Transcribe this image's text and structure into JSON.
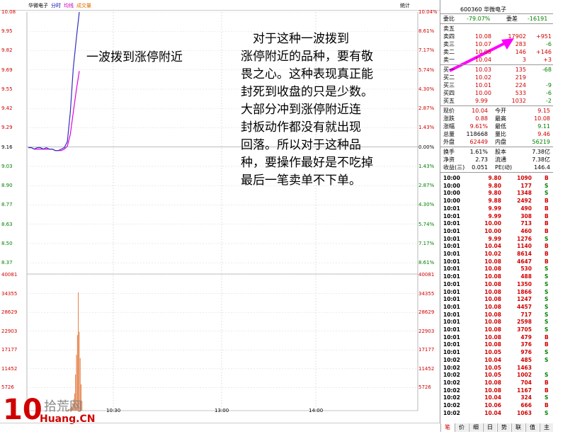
{
  "header": {
    "stock_name": "华微电子",
    "tab_fenshi": "分时",
    "tab_junxian": "均线",
    "tab_chengjiaoliang": "成交量",
    "tongji": "统计",
    "code_and_name": "600360 华微电子"
  },
  "left_axis_price": [
    "10.08",
    "9.95",
    "9.82",
    "9.69",
    "9.55",
    "9.42",
    "9.29",
    "9.16",
    "9.03",
    "8.90",
    "8.77",
    "8.63",
    "8.50",
    "8.37"
  ],
  "right_axis_pct": [
    "10.04%",
    "8.61%",
    "7.17%",
    "5.74%",
    "4.30%",
    "2.87%",
    "1.43%",
    "0.00%",
    "1.43%",
    "2.87%",
    "4.30%",
    "5.74%",
    "7.17%",
    "8.61%"
  ],
  "volume_axis": [
    "40081",
    "34355",
    "28629",
    "22903",
    "17177",
    "11452",
    "5726"
  ],
  "time_axis": [
    "10:30",
    "13:00",
    "14:00"
  ],
  "quote_panel": {
    "weibi_label": "委比",
    "weibi_value": "-79.07%",
    "weicha_label": "委差",
    "weicha_value": "-16191",
    "sells": [
      {
        "label": "卖五",
        "price": "",
        "vol": "",
        "chg": ""
      },
      {
        "label": "卖四",
        "price": "10.08",
        "vol": "17902",
        "chg": "+951"
      },
      {
        "label": "卖三",
        "price": "10.07",
        "vol": "283",
        "chg": "-6"
      },
      {
        "label": "卖二",
        "price": "10.05",
        "vol": "146",
        "chg": "+146"
      },
      {
        "label": "卖一",
        "price": "10.04",
        "vol": "3",
        "chg": "+3"
      }
    ],
    "buys": [
      {
        "label": "买一",
        "price": "10.03",
        "vol": "135",
        "chg": "-68"
      },
      {
        "label": "买二",
        "price": "10.02",
        "vol": "219",
        "chg": ""
      },
      {
        "label": "买三",
        "price": "10.01",
        "vol": "224",
        "chg": "-9"
      },
      {
        "label": "买四",
        "price": "10.00",
        "vol": "533",
        "chg": "-6"
      },
      {
        "label": "买五",
        "price": "9.99",
        "vol": "1032",
        "chg": "-2"
      }
    ],
    "stats": [
      {
        "l1": "现价",
        "v1": "10.04",
        "l2": "今开",
        "v2": "9.15",
        "c1": "red",
        "c2": "red"
      },
      {
        "l1": "涨跌",
        "v1": "0.88",
        "l2": "最高",
        "v2": "10.08",
        "c1": "red",
        "c2": "red"
      },
      {
        "l1": "涨幅",
        "v1": "9.61%",
        "l2": "最低",
        "v2": "9.11",
        "c1": "red",
        "c2": "grn"
      },
      {
        "l1": "总量",
        "v1": "118668",
        "l2": "量比",
        "v2": "9.46",
        "c1": "",
        "c2": "red"
      },
      {
        "l1": "外盘",
        "v1": "62449",
        "l2": "内盘",
        "v2": "56219",
        "c1": "red",
        "c2": "grn"
      }
    ],
    "stats2": [
      {
        "l1": "换手",
        "v1": "1.61%",
        "l2": "股本",
        "v2": "7.38亿"
      },
      {
        "l1": "净资",
        "v1": "2.73",
        "l2": "流通",
        "v2": "7.38亿"
      },
      {
        "l1": "收益(三)",
        "v1": "0.051",
        "l2": "PE(动)",
        "v2": "146.4"
      }
    ]
  },
  "ticks": [
    [
      "10:00",
      "9.80",
      "1090",
      "B"
    ],
    [
      "10:00",
      "9.80",
      "177",
      "S"
    ],
    [
      "10:00",
      "9.80",
      "1348",
      "S"
    ],
    [
      "10:00",
      "9.88",
      "2492",
      "B"
    ],
    [
      "10:01",
      "9.99",
      "490",
      "B"
    ],
    [
      "10:01",
      "9.99",
      "308",
      "B"
    ],
    [
      "10:01",
      "10.00",
      "713",
      "B"
    ],
    [
      "10:01",
      "10.00",
      "460",
      "B"
    ],
    [
      "10:01",
      "9.99",
      "1276",
      "S"
    ],
    [
      "10:01",
      "10.04",
      "1140",
      "B"
    ],
    [
      "10:01",
      "10.02",
      "8614",
      "B"
    ],
    [
      "10:01",
      "10.08",
      "4647",
      "B"
    ],
    [
      "10:01",
      "10.08",
      "530",
      "S"
    ],
    [
      "10:01",
      "10.08",
      "488",
      "S"
    ],
    [
      "10:01",
      "10.08",
      "1350",
      "S"
    ],
    [
      "10:01",
      "10.08",
      "1866",
      "S"
    ],
    [
      "10:01",
      "10.08",
      "1247",
      "S"
    ],
    [
      "10:01",
      "10.08",
      "4457",
      "S"
    ],
    [
      "10:01",
      "10.08",
      "717",
      "S"
    ],
    [
      "10:01",
      "10.08",
      "2598",
      "S"
    ],
    [
      "10:01",
      "10.08",
      "3705",
      "S"
    ],
    [
      "10:01",
      "10.08",
      "479",
      "B"
    ],
    [
      "10:01",
      "10.08",
      "376",
      "B"
    ],
    [
      "10:01",
      "10.05",
      "976",
      "S"
    ],
    [
      "10:02",
      "10.04",
      "485",
      "S"
    ],
    [
      "10:02",
      "10.05",
      "1463",
      ""
    ],
    [
      "10:02",
      "10.05",
      "1002",
      "S"
    ],
    [
      "10:02",
      "10.08",
      "704",
      "B"
    ],
    [
      "10:02",
      "10.08",
      "1167",
      "B"
    ],
    [
      "10:02",
      "10.04",
      "324",
      "S"
    ],
    [
      "10:02",
      "10.06",
      "666",
      "B"
    ],
    [
      "10:02",
      "10.04",
      "1063",
      "S"
    ]
  ],
  "bottom_tabs": [
    "笔",
    "价",
    "细",
    "日",
    "势",
    "联",
    "值",
    "主"
  ],
  "annotation_small": "一波拨到涨停附近",
  "annotation_big": [
    "　对于这种一波拨到",
    "涨停附近的品种，要有敬",
    "畏之心。这种表现真正能",
    "封死到收盘的只是少数。",
    "大部分冲到涨停附近连",
    "封板动作都没有就出现",
    "回落。所以对于这种品",
    "种，要操作最好是不吃掉",
    "最后一笔卖单不下单。"
  ],
  "watermark": {
    "num": "10",
    "text": "拾荒网",
    "domain": "Huang.CN"
  },
  "chart_data": {
    "type": "line",
    "series": [
      {
        "values": [
          9.16,
          9.16,
          9.15,
          9.16,
          9.16,
          9.15,
          9.16,
          9.15,
          9.15,
          9.14,
          9.14,
          9.15,
          9.16,
          9.2,
          9.4,
          9.7,
          9.9,
          10.08
        ]
      },
      {
        "values": [
          9.16,
          9.16,
          9.15,
          9.15,
          9.15,
          9.15,
          9.15,
          9.15,
          9.15,
          9.14,
          9.14,
          9.14,
          9.15,
          9.17,
          9.25,
          9.4,
          9.55,
          9.68
        ]
      }
    ],
    "ylim": [
      8.37,
      10.08
    ],
    "volume_series": [
      200,
      400,
      300,
      600,
      900,
      1200,
      2000,
      3500,
      5200,
      11000,
      17000,
      23000,
      36000,
      24000,
      16000,
      8000,
      3000
    ]
  }
}
